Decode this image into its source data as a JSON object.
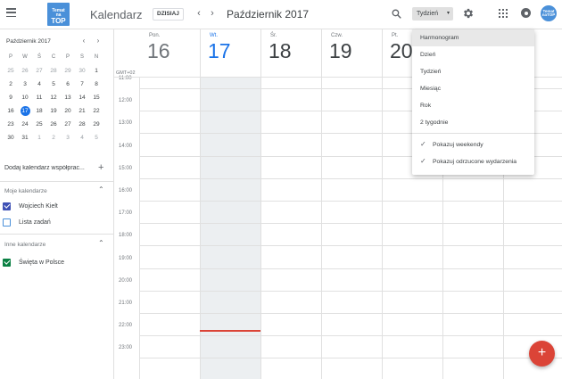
{
  "header": {
    "logo_line1": "Temat",
    "logo_line2": "na",
    "logo_line3": "TOP",
    "app_title": "Kalendarz",
    "today_button": "DZISIAJ",
    "prev_icon": "chevron-left-icon",
    "next_icon": "chevron-right-icon",
    "month_title": "Październik 2017",
    "view_selected": "Tydzień",
    "avatar_line1": "Temat",
    "avatar_line2": "naTOP"
  },
  "sidebar": {
    "mini_month": "Październik 2017",
    "weekdays": [
      "P",
      "W",
      "Ś",
      "C",
      "P",
      "S",
      "N"
    ],
    "weeks": [
      [
        "25",
        "26",
        "27",
        "28",
        "29",
        "30",
        "1"
      ],
      [
        "2",
        "3",
        "4",
        "5",
        "6",
        "7",
        "8"
      ],
      [
        "9",
        "10",
        "11",
        "12",
        "13",
        "14",
        "15"
      ],
      [
        "16",
        "17",
        "18",
        "19",
        "20",
        "21",
        "22"
      ],
      [
        "23",
        "24",
        "25",
        "26",
        "27",
        "28",
        "29"
      ],
      [
        "30",
        "31",
        "1",
        "2",
        "3",
        "4",
        "5"
      ]
    ],
    "today_date": "17",
    "add_calendar": "Dodaj kalendarz współprac...",
    "my_calendars_title": "Moje kalendarze",
    "my_calendars": [
      {
        "label": "Wojciech Kielt",
        "checked": true,
        "color": "#3f51b5"
      },
      {
        "label": "Lista zadań",
        "checked": false,
        "color": "#4a90d9"
      }
    ],
    "other_calendars_title": "Inne kalendarze",
    "other_calendars": [
      {
        "label": "Święta w Polsce",
        "checked": true,
        "color": "#0b8043"
      }
    ]
  },
  "main": {
    "days": [
      {
        "dow": "Pon.",
        "num": "16"
      },
      {
        "dow": "Wt.",
        "num": "17"
      },
      {
        "dow": "Śr.",
        "num": "18"
      },
      {
        "dow": "Czw.",
        "num": "19"
      },
      {
        "dow": "Pt.",
        "num": "20"
      }
    ],
    "timezone": "GMT+02",
    "hours": [
      "11:00",
      "12:00",
      "13:00",
      "14:00",
      "15:00",
      "16:00",
      "17:00",
      "18:00",
      "19:00",
      "20:00",
      "21:00",
      "22:00",
      "23:00"
    ]
  },
  "dropdown": {
    "items": [
      "Harmonogram",
      "Dzień",
      "Tydzień",
      "Miesiąc",
      "Rok",
      "2 tygodnie"
    ],
    "toggles": [
      "Pokazuj weekendy",
      "Pokazuj odrzucone wydarzenia"
    ]
  },
  "colors": {
    "accent": "#1a73e8",
    "fab": "#db4437",
    "now_line": "#db4437"
  }
}
